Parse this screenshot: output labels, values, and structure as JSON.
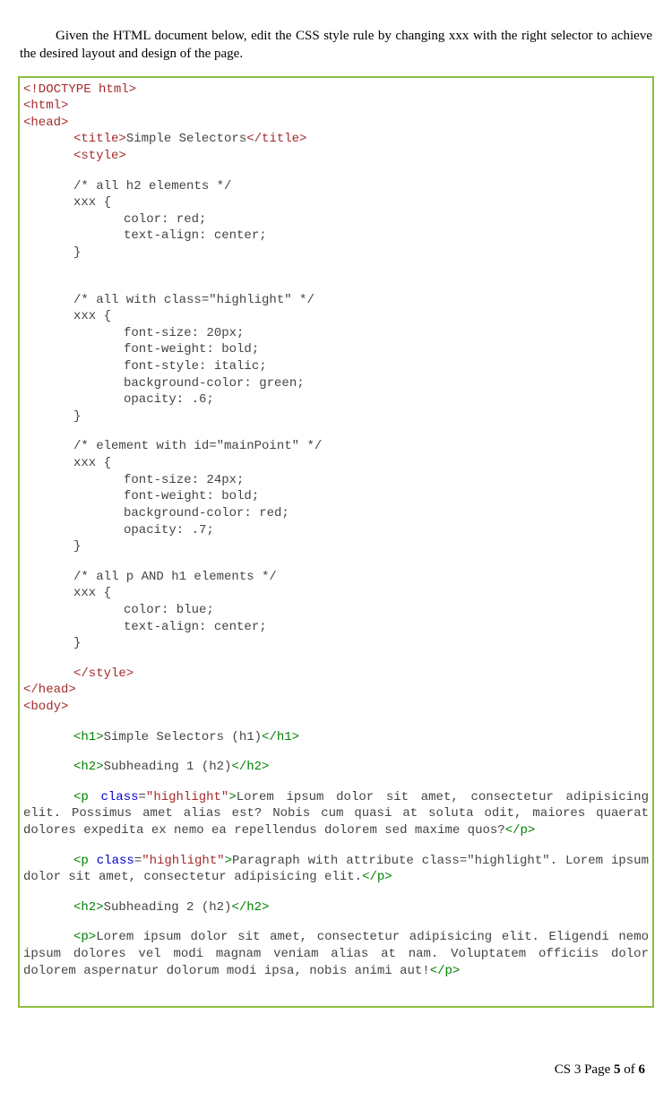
{
  "instruction": "Given the HTML document below, edit the CSS style rule by changing xxx with the right selector to achieve the desired layout and design of the page.",
  "code": {
    "l1": "<!DOCTYPE html>",
    "l2": "<html>",
    "l3": "<head>",
    "l4a": "<title>",
    "l4b": "Simple Selectors",
    "l4c": "</title>",
    "l5": "<style>",
    "c1": "/* all h2 elements */",
    "x1a": "xxx {",
    "x1b": "color: red;",
    "x1c": "text-align: center;",
    "x1d": "}",
    "c2": "/* all with class=\"highlight\" */",
    "x2a": "xxx {",
    "x2b": "font-size: 20px;",
    "x2c": "font-weight: bold;",
    "x2d": "font-style: italic;",
    "x2e": "background-color: green;",
    "x2f": "opacity: .6;",
    "x2g": "}",
    "c3": "/* element with id=\"mainPoint\" */",
    "x3a": "xxx {",
    "x3b": "font-size: 24px;",
    "x3c": "font-weight: bold;",
    "x3d": "background-color: red;",
    "x3e": "opacity: .7;",
    "x3f": "}",
    "c4": "/* all p AND h1 elements */",
    "x4a": "xxx {",
    "x4b": "color: blue;",
    "x4c": "text-align: center;",
    "x4d": "}",
    "l6": "</style>",
    "l7": "</head>",
    "l8": "<body>",
    "h1open": "<h1>",
    "h1text": "Simple Selectors (h1)",
    "h1close": "</h1>",
    "h2aopen": "<h2>",
    "h2atext": "Subheading 1 (h2)",
    "h2aclose": "</h2>",
    "p1open": "<p ",
    "p1class": "class",
    "p1eq": "=",
    "p1val": "\"highlight\"",
    "p1close0": ">",
    "p1text": "Lorem ipsum dolor sit amet, consectetur adipisicing elit. Possimus amet alias est? Nobis cum quasi at soluta odit, maiores quaerat dolores expedita ex nemo ea repellendus dolorem sed maxime quos?",
    "pclose": "</p>",
    "p2open": "<p ",
    "p2text": "Paragraph with attribute class=\"highlight\". Lorem ipsum dolor sit amet, consectetur adipisicing elit.",
    "h2bopen": "<h2>",
    "h2btext": "Subheading 2 (h2)",
    "h2bclose": "</h2>",
    "p3open": "<p>",
    "p3text": "Lorem ipsum dolor sit amet, consectetur adipisicing elit. Eligendi nemo ipsum dolores vel modi magnam veniam alias at nam. Voluptatem officiis dolor dolorem aspernatur dolorum modi ipsa, nobis animi aut!"
  },
  "footer": {
    "prefix": "CS 3 Page ",
    "page": "5",
    "of": " of ",
    "total": "6"
  }
}
